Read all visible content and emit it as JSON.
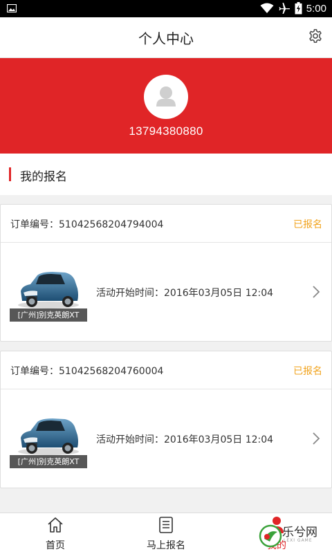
{
  "status_bar": {
    "time": "5:00",
    "icons": [
      "image-icon",
      "wifi-icon",
      "airplane-icon",
      "battery-icon"
    ]
  },
  "header": {
    "title": "个人中心",
    "settings_icon": "gear-icon"
  },
  "profile": {
    "phone": "13794380880",
    "avatar_icon": "user-avatar-icon"
  },
  "section": {
    "title": "我的报名"
  },
  "orders": [
    {
      "order_no": "订单编号：51042568204794004",
      "status": "已报名",
      "car_caption": "[广州]别克英朗XT",
      "activity_time": "活动开始时间：2016年03月05日 12:04"
    },
    {
      "order_no": "订单编号：51042568204760004",
      "status": "已报名",
      "car_caption": "[广州]别克英朗XT",
      "activity_time": "活动开始时间：2016年03月05日 12:04"
    }
  ],
  "tabbar": {
    "tabs": [
      {
        "label": "首页",
        "icon": "home-icon"
      },
      {
        "label": "马上报名",
        "icon": "list-icon"
      },
      {
        "label": "我的",
        "icon": "user-icon"
      }
    ]
  },
  "watermark": {
    "text": "乐兮网",
    "sub": "LEXI GAME"
  },
  "colors": {
    "accent": "#e02527",
    "status": "#f1a31c",
    "background": "#f1f1f1"
  }
}
